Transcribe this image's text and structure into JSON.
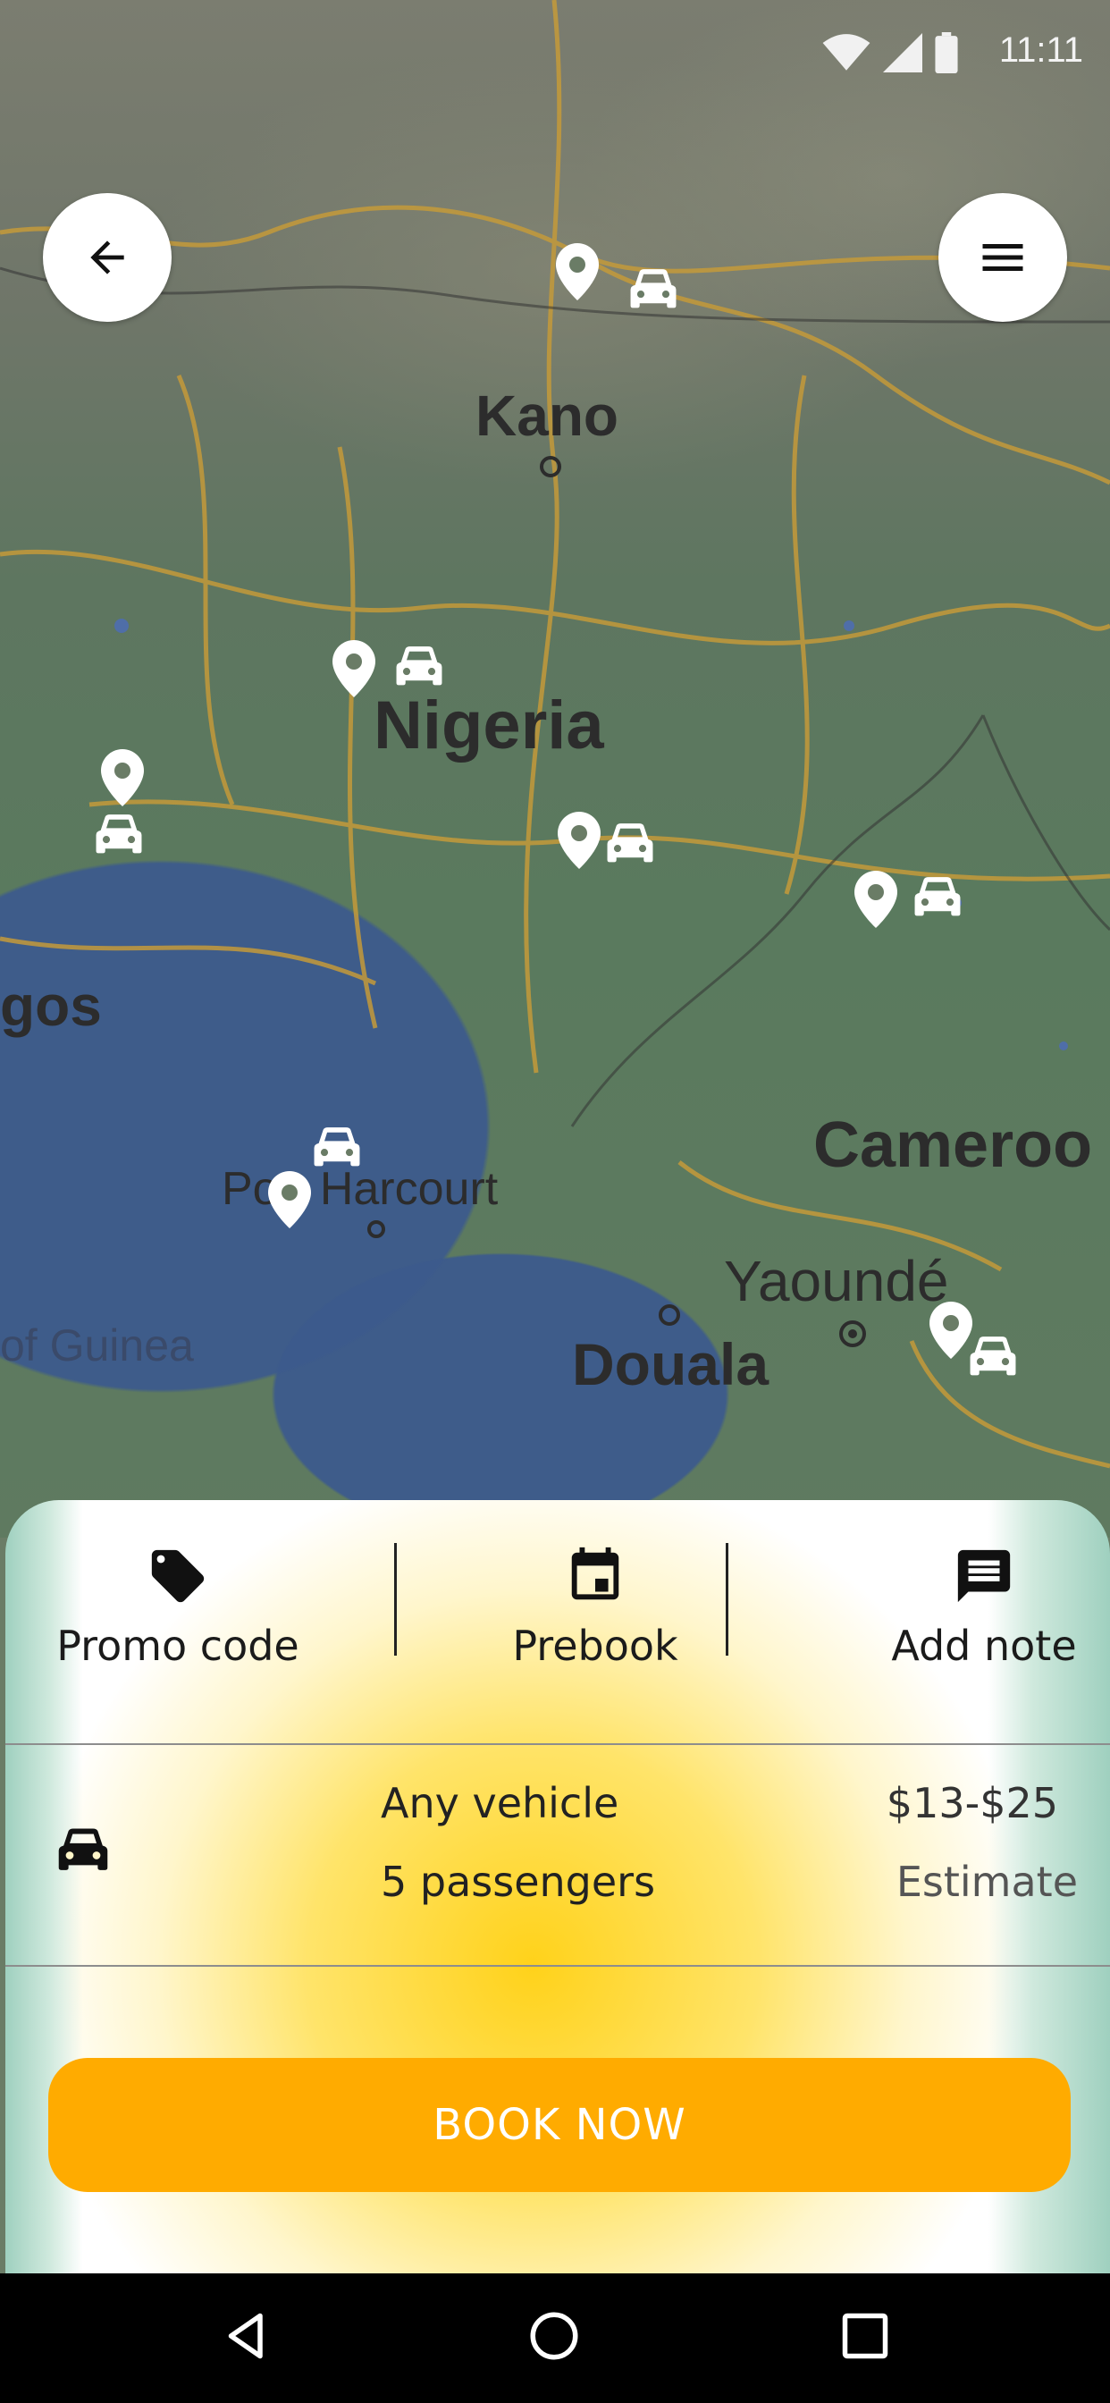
{
  "status_bar": {
    "time": "11:11"
  },
  "map": {
    "labels": {
      "kano": "Kano",
      "nigeria": "Nigeria",
      "lagos": "gos",
      "port_harcourt": "Port Harcourt",
      "cameroon": "Cameroo",
      "yaounde": "Yaoundé",
      "douala": "Douala",
      "gulf": "of Guinea"
    }
  },
  "actions": {
    "promo_label": "Promo code",
    "prebook_label": "Prebook",
    "note_label": "Add note"
  },
  "vehicle": {
    "name": "Any vehicle",
    "passengers": "5 passengers",
    "price": "$13-$25",
    "estimate_label": "Estimate"
  },
  "book_button": {
    "label": "BOOK NOW"
  },
  "colors": {
    "accent": "#ffab00",
    "sheet_highlight": "#ffd21a"
  },
  "icons": [
    "back-arrow-icon",
    "menu-icon",
    "location-pin-icon",
    "car-icon",
    "tag-icon",
    "calendar-icon",
    "note-icon",
    "nav-back-icon",
    "nav-home-icon",
    "nav-recents-icon",
    "wifi-icon",
    "signal-icon",
    "battery-icon"
  ]
}
